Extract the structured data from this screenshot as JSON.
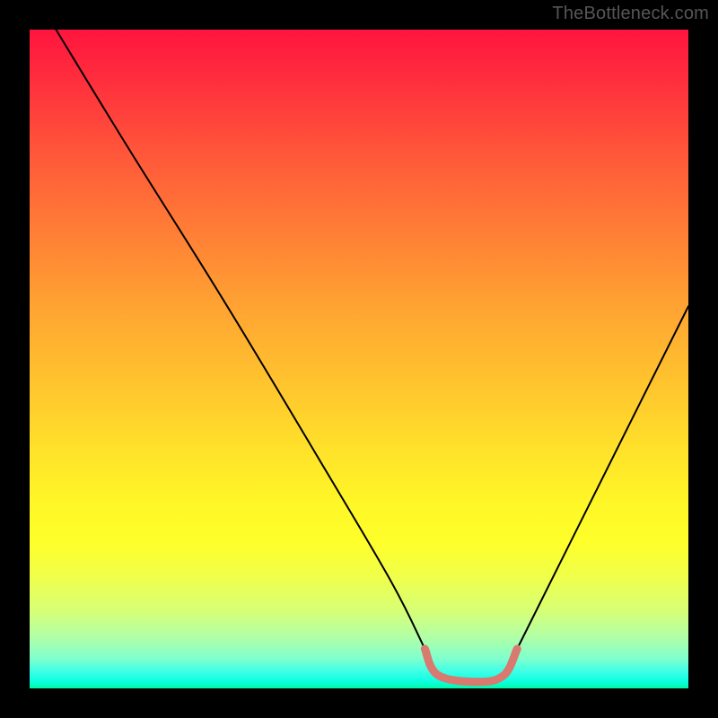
{
  "watermark": "TheBottleneck.com",
  "chart_data": {
    "type": "line",
    "title": "",
    "xlabel": "",
    "ylabel": "",
    "xlim": [
      0,
      100
    ],
    "ylim": [
      0,
      100
    ],
    "grid": false,
    "legend": false,
    "series": [
      {
        "name": "bottleneck-curve",
        "color": "#000000",
        "x": [
          4,
          15,
          30,
          45,
          55,
          60,
          62,
          68,
          72,
          74,
          80,
          90,
          100
        ],
        "y": [
          100,
          82,
          58,
          33,
          16,
          6,
          2,
          1,
          2,
          6,
          18,
          38,
          58
        ]
      },
      {
        "name": "optimal-band",
        "color": "#d87a6f",
        "x": [
          60,
          62,
          68,
          72,
          74
        ],
        "y": [
          6,
          2,
          1,
          2,
          6
        ]
      }
    ],
    "annotations": []
  }
}
